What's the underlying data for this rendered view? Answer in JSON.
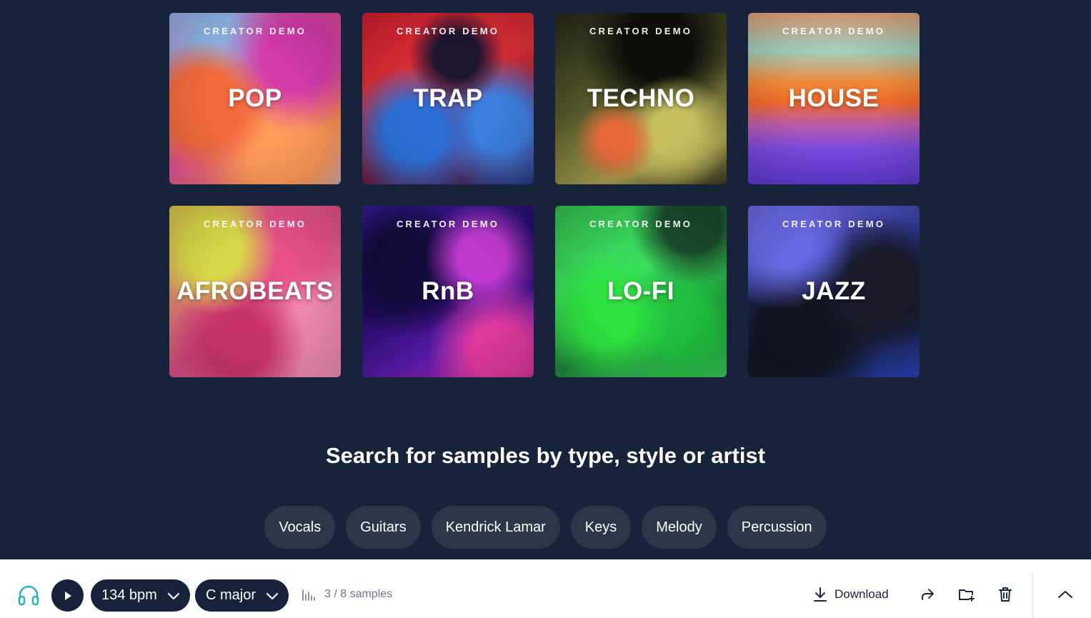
{
  "cards": [
    {
      "kicker": "CREATOR DEMO",
      "genre": "POP"
    },
    {
      "kicker": "CREATOR DEMO",
      "genre": "TRAP"
    },
    {
      "kicker": "CREATOR DEMO",
      "genre": "TECHNO"
    },
    {
      "kicker": "CREATOR DEMO",
      "genre": "HOUSE"
    },
    {
      "kicker": "CREATOR DEMO",
      "genre": "AFROBEATS"
    },
    {
      "kicker": "CREATOR DEMO",
      "genre": "RnB"
    },
    {
      "kicker": "CREATOR DEMO",
      "genre": "LO-FI"
    },
    {
      "kicker": "CREATOR DEMO",
      "genre": "JAZZ"
    }
  ],
  "search": {
    "heading": "Search for samples by type, style or artist",
    "chips": [
      "Vocals",
      "Guitars",
      "Kendrick Lamar",
      "Keys",
      "Melody",
      "Percussion"
    ]
  },
  "player": {
    "bpm": "134 bpm",
    "key": "C major",
    "samples": "3 / 8 samples",
    "download_label": "Download"
  },
  "colors": {
    "background": "#16233a",
    "chip": "#2b3749",
    "player_bg": "#ffffff",
    "headphones_accent": "#2bb3c0"
  }
}
